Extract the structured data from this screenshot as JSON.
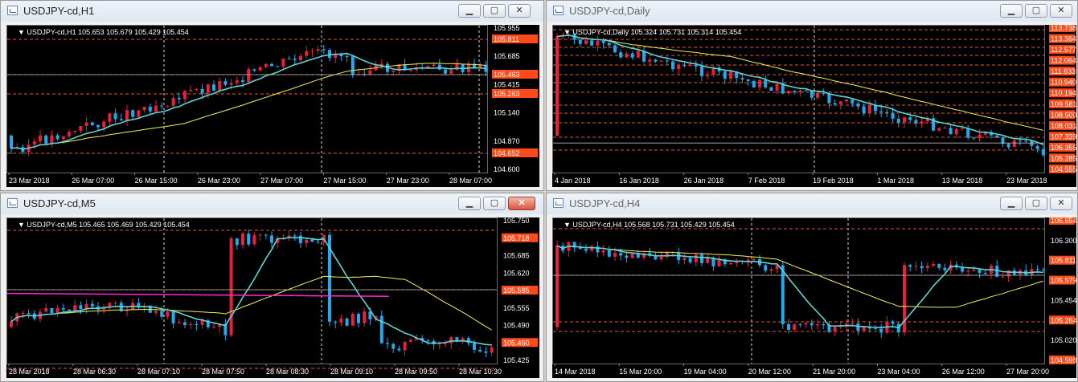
{
  "windows": [
    {
      "id": "h1",
      "title": "USDJPY-cd,H1",
      "header": "USDJPY-cd,H1  105.653 105.679 105.429 105.454",
      "active_close": false,
      "price_labels": [
        "105.955",
        "105.685",
        "105.415",
        "105.140",
        "104.870",
        "104.600"
      ],
      "level_labels": [
        {
          "text": "105.811",
          "highlight": true
        },
        {
          "text": "105.463",
          "highlight": true
        },
        {
          "text": "105.263",
          "highlight": true
        },
        {
          "text": "104.652",
          "highlight": true
        }
      ],
      "time_labels": [
        "23 Mar 2018",
        "26 Mar 07:00",
        "26 Mar 15:00",
        "26 Mar 23:00",
        "27 Mar 07:00",
        "27 Mar 15:00",
        "27 Mar 23:00",
        "28 Mar 07:00"
      ]
    },
    {
      "id": "daily",
      "title": "USDJPY-cd,Daily",
      "header": "USDJPY-cd,Daily  105.324 105.731 105.314 105.454",
      "active_close": false,
      "price_labels": [
        "113.738",
        "113.364",
        "112.577",
        "112.064",
        "111.633",
        "110.940",
        "110.194",
        "109.581",
        "108.500",
        "108.031",
        "107.339",
        "106.355",
        "105.285",
        "104.555"
      ],
      "time_labels": [
        "4 Jan 2018",
        "16 Jan 2018",
        "26 Jan 2018",
        "7 Feb 2018",
        "19 Feb 2018",
        "1 Mar 2018",
        "13 Mar 2018",
        "23 Mar 2018"
      ]
    },
    {
      "id": "m5",
      "title": "USDJPY-cd,M5",
      "header": "USDJPY-cd,M5  105.465 105.469 105.429 105.454",
      "active_close": true,
      "price_labels": [
        "105.750",
        "105.718",
        "105.685",
        "105.620",
        "105.585",
        "105.555",
        "105.490",
        "105.460",
        "105.425"
      ],
      "time_labels": [
        "28 Mar 2018",
        "28 Mar 06:30",
        "28 Mar 07:10",
        "28 Mar 07:50",
        "28 Mar 08:30",
        "28 Mar 09:10",
        "28 Mar 09:50",
        "28 Mar 10:30"
      ]
    },
    {
      "id": "h4",
      "title": "USDJPY-cd,H4",
      "header": "USDJPY-cd,H4  105.568 105.731 105.429 105.454",
      "active_close": false,
      "price_labels": [
        "106.654",
        "106.300",
        "105.811",
        "105.579",
        "105.454",
        "105.264",
        "105.020",
        "104.598"
      ],
      "time_labels": [
        "14 Mar 2018",
        "15 Mar 20:00",
        "19 Mar 04:00",
        "20 Mar 12:00",
        "21 Mar 20:00",
        "23 Mar 04:00",
        "26 Mar 12:00",
        "27 Mar 20:00"
      ]
    }
  ],
  "colors": {
    "bull": "#e6213d",
    "bear": "#22aaf0",
    "ma_fast": "#5ad6d6",
    "ma_slow": "#f2f25a",
    "ma_magenta": "#ff2bd6",
    "level": "#e05a20",
    "label_bg": "#ff4a1a"
  }
}
